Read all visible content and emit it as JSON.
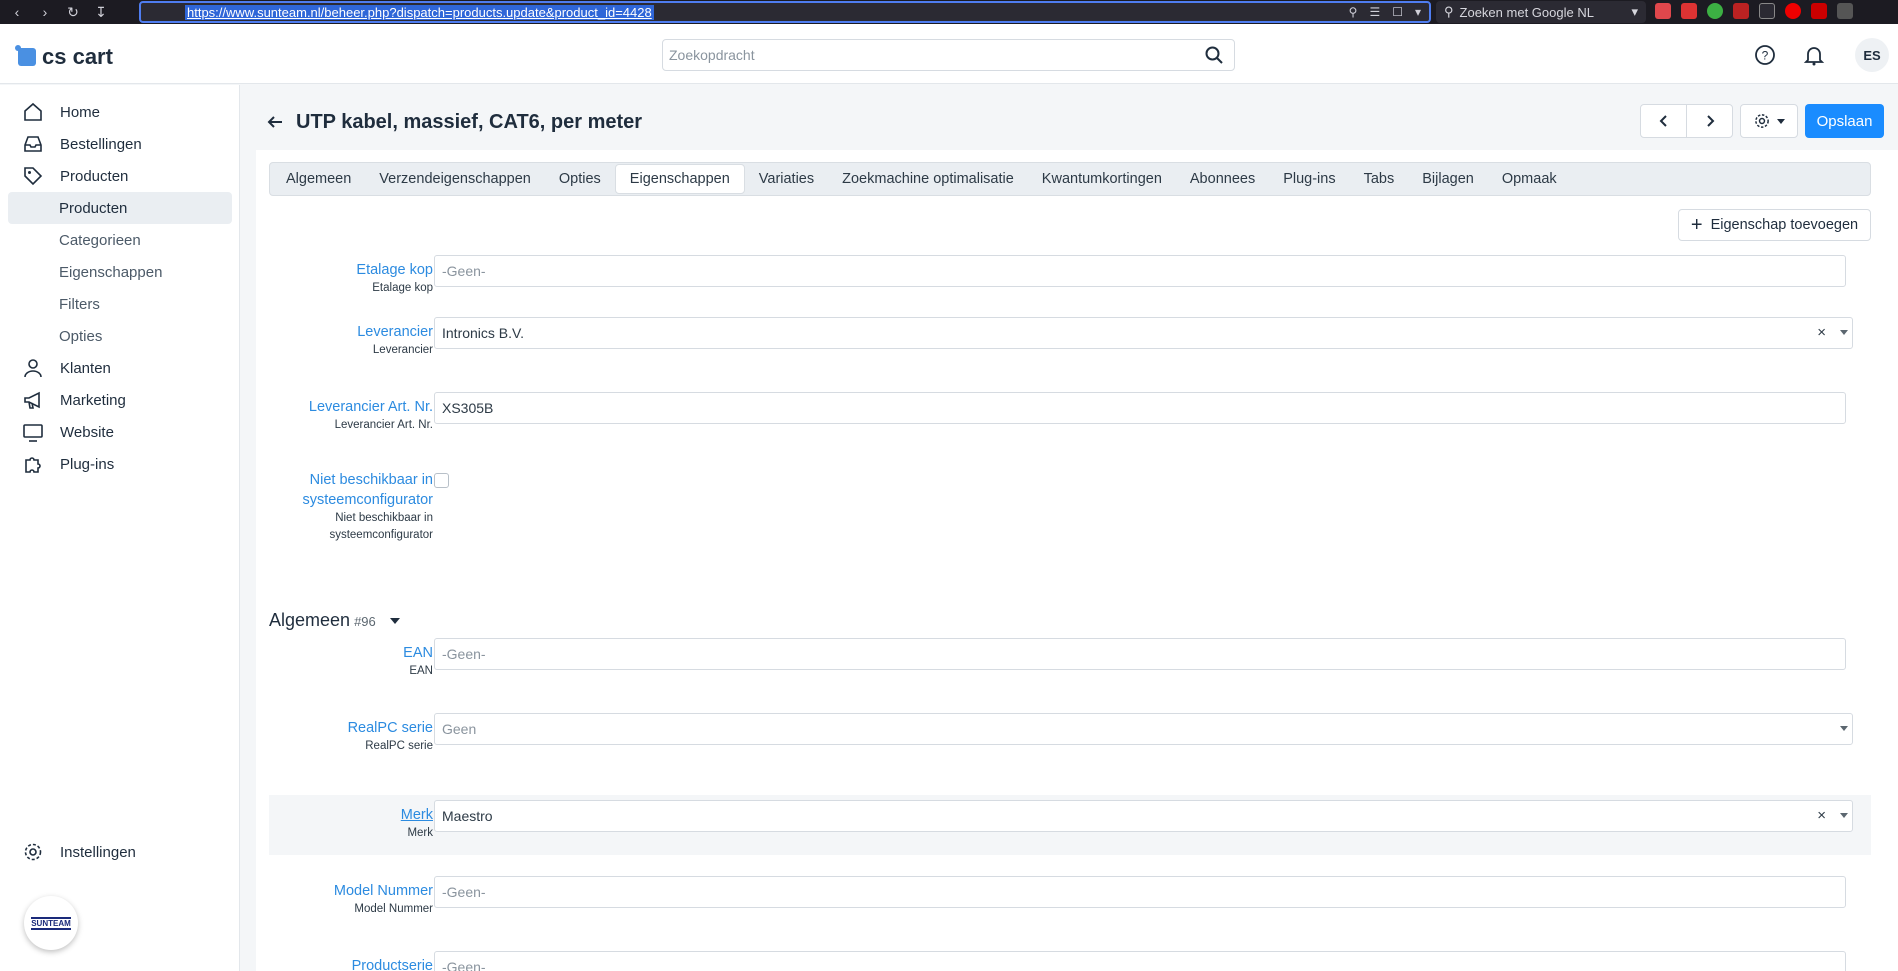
{
  "browser": {
    "url": "https://www.sunteam.nl/beheer.php?dispatch=products.update&product_id=4428",
    "search_placeholder": "Zoeken met Google NL"
  },
  "header": {
    "logo_text": "cs cart",
    "search_placeholder": "Zoekopdracht",
    "avatar_initials": "ES"
  },
  "sidebar": {
    "items": [
      {
        "label": "Home",
        "icon": "home-icon"
      },
      {
        "label": "Bestellingen",
        "icon": "inbox-icon"
      },
      {
        "label": "Producten",
        "icon": "tag-icon"
      },
      {
        "label": "Producten"
      },
      {
        "label": "Categorieen"
      },
      {
        "label": "Eigenschappen"
      },
      {
        "label": "Filters"
      },
      {
        "label": "Opties"
      },
      {
        "label": "Klanten",
        "icon": "user-icon"
      },
      {
        "label": "Marketing",
        "icon": "megaphone-icon"
      },
      {
        "label": "Website",
        "icon": "monitor-icon"
      },
      {
        "label": "Plug-ins",
        "icon": "puzzle-icon"
      }
    ],
    "settings_label": "Instellingen",
    "brand_text": "SUNTEAM"
  },
  "page": {
    "title": "UTP kabel, massief, CAT6, per meter",
    "save_label": "Opslaan",
    "add_property_label": "Eigenschap toevoegen"
  },
  "tabs": [
    "Algemeen",
    "Verzendeigenschappen",
    "Opties",
    "Eigenschappen",
    "Variaties",
    "Zoekmachine optimalisatie",
    "Kwantumkortingen",
    "Abonnees",
    "Plug-ins",
    "Tabs",
    "Bijlagen",
    "Opmaak"
  ],
  "active_tab": "Eigenschappen",
  "fields": {
    "etalage": {
      "label": "Etalage kop",
      "sub": "Etalage kop",
      "placeholder": "-Geen-"
    },
    "leverancier": {
      "label": "Leverancier",
      "sub": "Leverancier",
      "value": "Intronics B.V."
    },
    "art_nr": {
      "label": "Leverancier Art. Nr.",
      "sub": "Leverancier Art. Nr.",
      "value": "XS305B"
    },
    "niet_beschikbaar": {
      "label_line1": "Niet beschikbaar in",
      "label_line2": "systeemconfigurator",
      "sub_line1": "Niet beschikbaar in",
      "sub_line2": "systeemconfigurator",
      "checked": false
    }
  },
  "section": {
    "title": "Algemeen",
    "count": "#96"
  },
  "section_fields": {
    "ean": {
      "label": "EAN",
      "sub": "EAN",
      "placeholder": "-Geen-"
    },
    "realpc": {
      "label": "RealPC serie",
      "sub": "RealPC serie",
      "value": "Geen"
    },
    "merk": {
      "label": "Merk",
      "sub": "Merk",
      "value": "Maestro"
    },
    "model": {
      "label": "Model Nummer",
      "sub": "Model Nummer",
      "placeholder": "-Geen-"
    },
    "productserie": {
      "label": "Productserie",
      "placeholder": "-Geen-"
    }
  },
  "colors": {
    "accent": "#1a8cff",
    "link": "#2c8be0"
  }
}
